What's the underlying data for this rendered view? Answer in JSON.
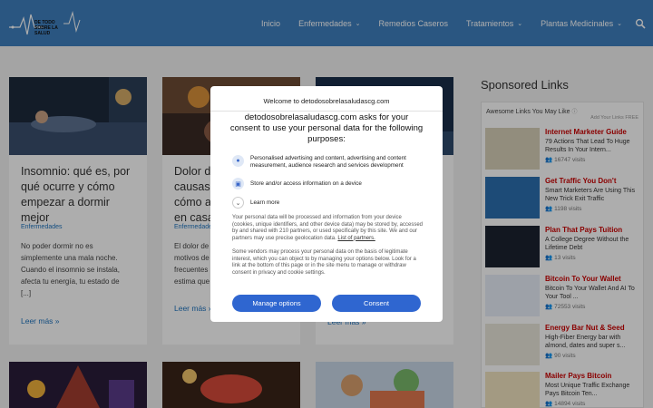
{
  "header": {
    "logo_text": "DE TODO SOBRE LA SALUD",
    "nav": [
      {
        "label": "Inicio",
        "dropdown": false
      },
      {
        "label": "Enfermedades",
        "dropdown": true
      },
      {
        "label": "Remedios Caseros",
        "dropdown": false
      },
      {
        "label": "Tratamientos",
        "dropdown": true
      },
      {
        "label": "Plantas Medicinales",
        "dropdown": true
      }
    ]
  },
  "cards": [
    {
      "title_lines": [
        "Insomnio: qué es, por",
        "qué ocurre y cómo",
        "empezar a dormir",
        "mejor"
      ],
      "category": "Enfermedades",
      "excerpt_lines": [
        "No poder dormir no es",
        "simplemente una mala noche.",
        "Cuando el insomnio se instala,",
        "afecta tu energía, tu estado de",
        "[...]"
      ],
      "more": "Leer más »"
    },
    {
      "title_lines": [
        "Dolor d",
        "causas,",
        "cómo a",
        "en casa"
      ],
      "category": "Enfermedades",
      "excerpt_lines": [
        "El dolor de",
        "motivos de",
        "frecuentes",
        "estima que"
      ],
      "more": "Leer más »"
    },
    {
      "more": "Leer más »"
    }
  ],
  "sidebar": {
    "title": "Sponsored Links",
    "widget_head": "Awesome Links You May Like",
    "widget_sub": "Add Your Links FREE",
    "ads": [
      {
        "title": "Internet Marketer Guide",
        "desc": "79 Actions That Lead To Huge Results In Your Intern...",
        "visits": "16747 visits",
        "color": "#d8d0b8"
      },
      {
        "title": "Get Traffic You Don't",
        "desc": "Smart Marketers Are Using This New Trick Exit Traffic",
        "visits": "1198 visits",
        "color": "#2c6fb0"
      },
      {
        "title": "Plan That Pays Tuition",
        "desc": "A College Degree Without the Lifetime Debt",
        "visits": "13 visits",
        "color": "#1b2330"
      },
      {
        "title": "Bitcoin To Your Wallet",
        "desc": "Bitcoin To Your Wallet And AI To Your Tool ...",
        "visits": "72553 visits",
        "color": "#e8eef8"
      },
      {
        "title": "Energy Bar Nut & Seed",
        "desc": "High-Fiber Energy bar with almond, dates and super s...",
        "visits": "90 visits",
        "color": "#e9e6da"
      },
      {
        "title": "Mailer Pays Bitcoin",
        "desc": "Most Unique Traffic Exchange Pays Bitcoin Ten...",
        "visits": "14894 visits",
        "color": "#f0e4c0"
      }
    ]
  },
  "consent": {
    "welcome": "Welcome to detodosobrelasaludascg.com",
    "heading": "detodosobrelasaludascg.com asks for your consent to use your personal data for the following purposes:",
    "purposes": [
      "Personalised advertising and content, advertising and content measurement, audience research and services development",
      "Store and/or access information on a device"
    ],
    "learn_more": "Learn more",
    "body1": "Your personal data will be processed and information from your device (cookies, unique identifiers, and other device data) may be stored by, accessed by and shared with 210 partners, or used specifically by this site. We and our partners may use precise geolocation data.",
    "partners_link": "List of partners.",
    "body2": "Some vendors may process your personal data on the basis of legitimate interest, which you can object to by managing your options below. Look for a link at the bottom of this page or in the site menu to manage or withdraw consent in privacy and cookie settings.",
    "manage_label": "Manage options",
    "consent_label": "Consent"
  }
}
